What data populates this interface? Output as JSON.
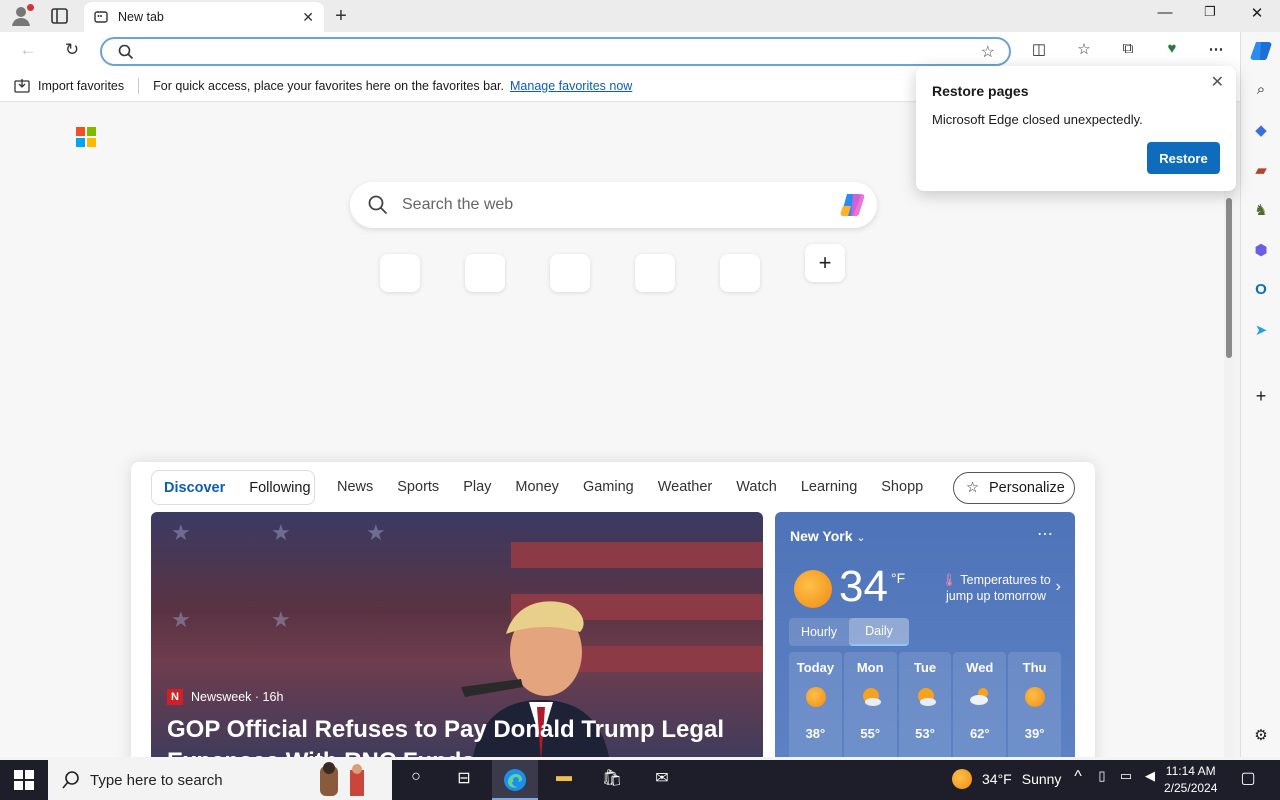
{
  "tab": {
    "title": "New tab"
  },
  "address": {
    "value": "",
    "placeholder": ""
  },
  "favorites_bar": {
    "import_label": "Import favorites",
    "hint": "For quick access, place your favorites here on the favorites bar.",
    "manage_link": "Manage favorites now"
  },
  "newtab": {
    "search_placeholder": "Search the web",
    "quick_links_count": 5
  },
  "feed": {
    "pivots": [
      "Discover",
      "Following"
    ],
    "categories": [
      "News",
      "Sports",
      "Play",
      "Money",
      "Gaming",
      "Weather",
      "Watch",
      "Learning",
      "Shopp"
    ],
    "personalize_label": "Personalize",
    "hero": {
      "source": "Newsweek · 16h",
      "title": "GOP Official Refuses to Pay Donald Trump Legal Expenses With RNC Funds"
    }
  },
  "weather": {
    "city": "New York",
    "temp": "34",
    "unit": "°F",
    "note": "Temperatures to jump up tomorrow",
    "toggle": [
      "Hourly",
      "Daily"
    ],
    "days": [
      {
        "day": "Today",
        "temp": "38°",
        "icon": "sunny"
      },
      {
        "day": "Mon",
        "temp": "55°",
        "icon": "partly-cloudy"
      },
      {
        "day": "Tue",
        "temp": "53°",
        "icon": "partly-cloudy"
      },
      {
        "day": "Wed",
        "temp": "62°",
        "icon": "cloudy"
      },
      {
        "day": "Thu",
        "temp": "39°",
        "icon": "sunny"
      }
    ]
  },
  "popup": {
    "title": "Restore pages",
    "message": "Microsoft Edge closed unexpectedly.",
    "button": "Restore"
  },
  "taskbar": {
    "search_placeholder": "Type here to search",
    "weather_temp": "34°F",
    "weather_text": "Sunny",
    "time": "11:14 AM",
    "date": "2/25/2024"
  },
  "colors": {
    "accent": "#0f6cbd",
    "link": "#0f5cb5",
    "weather_bg": "#5679bd"
  }
}
